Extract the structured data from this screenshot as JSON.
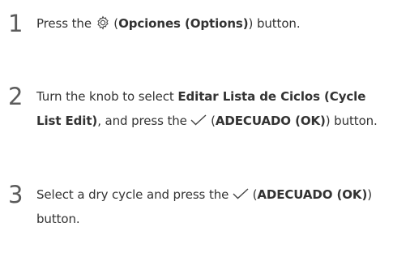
{
  "steps": [
    {
      "number": "1",
      "text_before": "Press the ",
      "icon": "gear-icon",
      "text_open": " (",
      "bold": "Opciones (Options)",
      "text_after": ") button."
    },
    {
      "number": "2",
      "text_before": "Turn the knob to select ",
      "bold_1": "Editar Lista de Ciclos (Cycle List Edit)",
      "text_middle": ", and press the ",
      "icon": "checkmark-icon",
      "text_open": " (",
      "bold_2": "ADECUADO (OK)",
      "text_after": ") button."
    },
    {
      "number": "3",
      "text_before": "Select a dry cycle and press the ",
      "icon": "checkmark-icon",
      "text_open": " (",
      "bold": "ADECUADO (OK)",
      "text_after": ") button."
    }
  ]
}
